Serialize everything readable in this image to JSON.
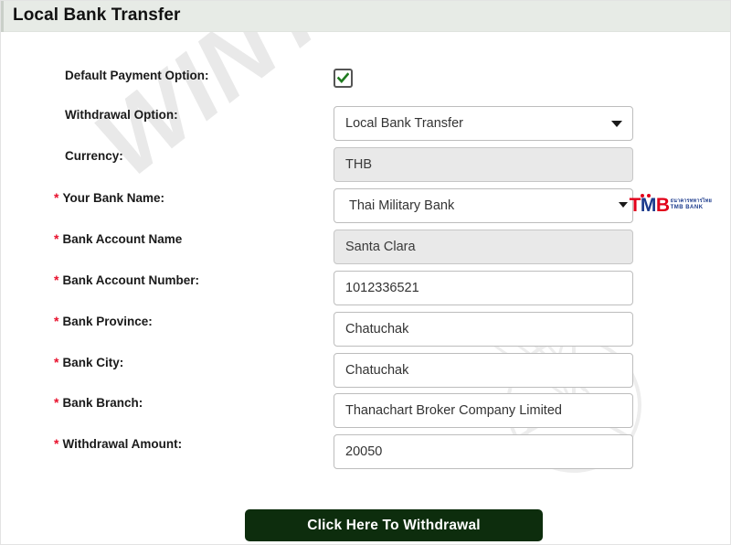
{
  "header": {
    "title": "Local Bank Transfer"
  },
  "watermark": {
    "text": "WINTIPS",
    "mark": "circular-emblem"
  },
  "form": {
    "rows": [
      {
        "label": "Default Payment Option:",
        "required": false,
        "control": "checkbox",
        "checked": true,
        "value": ""
      },
      {
        "label": "Withdrawal Option:",
        "required": false,
        "control": "select",
        "value": "Local Bank Transfer",
        "options": [
          "Local Bank Transfer"
        ],
        "disabled": false
      },
      {
        "label": "Currency:",
        "required": false,
        "control": "text",
        "value": "THB",
        "disabled": true
      },
      {
        "label": "Your Bank Name:",
        "required": true,
        "control": "select-bank",
        "value": "Thai Military Bank",
        "options": [
          "Thai Military Bank"
        ],
        "disabled": false
      },
      {
        "label": "Bank Account Name",
        "required": true,
        "control": "text",
        "value": "Santa Clara",
        "disabled": true
      },
      {
        "label": "Bank Account Number:",
        "required": true,
        "control": "text",
        "value": "1012336521",
        "disabled": false
      },
      {
        "label": "Bank Province:",
        "required": true,
        "control": "text",
        "value": "Chatuchak",
        "disabled": false
      },
      {
        "label": "Bank City:",
        "required": true,
        "control": "text",
        "value": "Chatuchak",
        "disabled": false
      },
      {
        "label": "Bank Branch:",
        "required": true,
        "control": "text",
        "value": "Thanachart Broker Company Limited",
        "disabled": false
      },
      {
        "label": "Withdrawal Amount:",
        "required": true,
        "control": "text",
        "value": "20050",
        "disabled": false
      }
    ],
    "required_marker": "*"
  },
  "bank_logo": {
    "letter_t": "T",
    "letter_m": "M",
    "letter_b": "B",
    "thai_text": "ธนาคารทหารไทย",
    "english_text": "TMB BANK",
    "color_red": "#e2001a",
    "color_blue": "#1b3a8c"
  },
  "submit": {
    "label": "Click Here To Withdrawal",
    "color": "#0d2d0d"
  },
  "colors": {
    "header_bg": "#e7ebe6",
    "required_star": "#e8112d",
    "disabled_field": "#e9e9e9",
    "check_green": "#1f7a1f"
  }
}
